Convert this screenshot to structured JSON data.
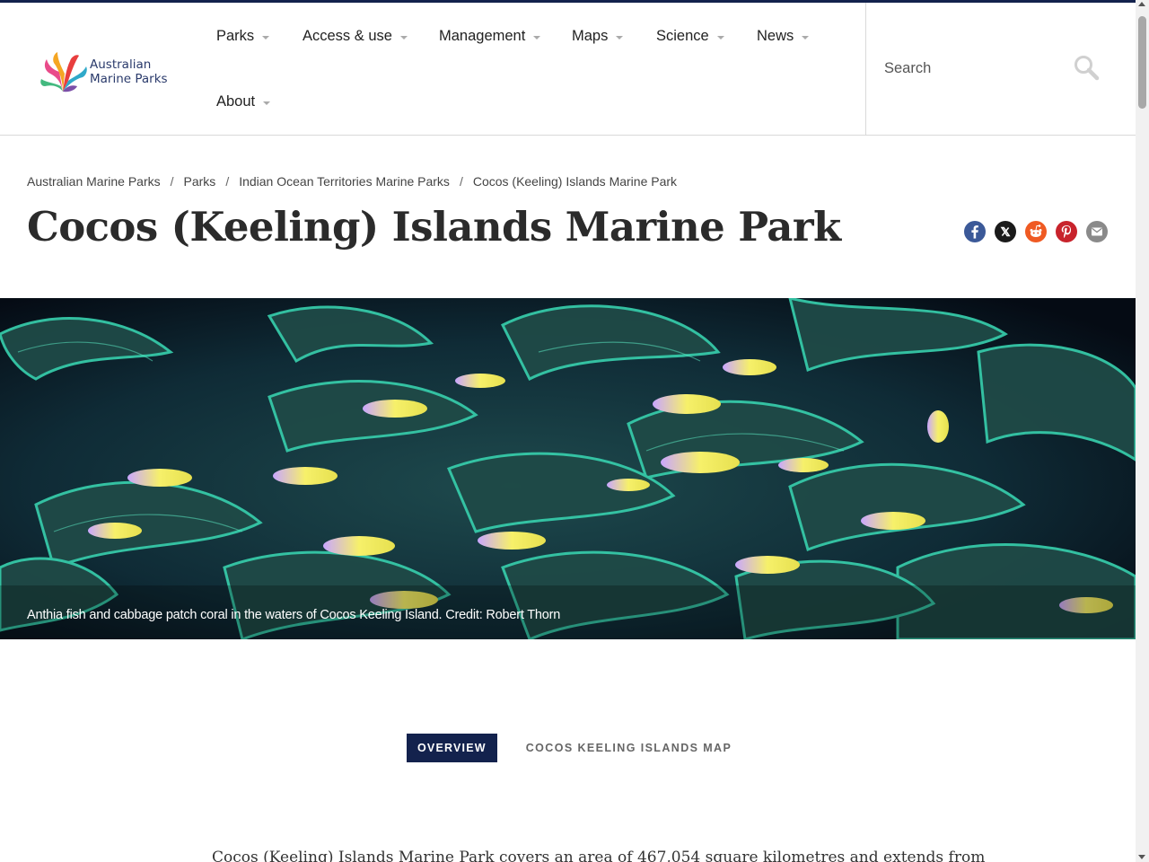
{
  "site": {
    "logo_line1": "Australian",
    "logo_line2": "Marine Parks"
  },
  "nav": {
    "items": [
      {
        "label": "Parks"
      },
      {
        "label": "Access & use"
      },
      {
        "label": "Management"
      },
      {
        "label": "Maps"
      },
      {
        "label": "Science"
      },
      {
        "label": "News"
      },
      {
        "label": "About"
      }
    ]
  },
  "search": {
    "placeholder": "Search"
  },
  "breadcrumb": [
    {
      "label": "Australian Marine Parks"
    },
    {
      "label": "Parks"
    },
    {
      "label": "Indian Ocean Territories Marine Parks"
    },
    {
      "label": "Cocos (Keeling) Islands Marine Park"
    }
  ],
  "page": {
    "title": "Cocos (Keeling) Islands Marine Park"
  },
  "share": {
    "icons": [
      "facebook-icon",
      "x-icon",
      "reddit-icon",
      "pinterest-icon",
      "email-icon"
    ],
    "colors": {
      "facebook": "#3b5998",
      "x": "#1a1a1a",
      "reddit": "#ef5a23",
      "pinterest": "#c8232c",
      "email": "#8a8a8a"
    }
  },
  "hero": {
    "caption": "Anthia fish and cabbage patch coral in the waters of Cocos Keeling Island. Credit: Robert Thorn"
  },
  "tabs": {
    "active": "OVERVIEW",
    "other": "COCOS KEELING ISLANDS MAP"
  },
  "intro": {
    "text": "Cocos (Keeling) Islands Marine Park covers an area of 467,054 square kilometres and extends from"
  },
  "colors": {
    "brand_navy": "#13224d"
  }
}
